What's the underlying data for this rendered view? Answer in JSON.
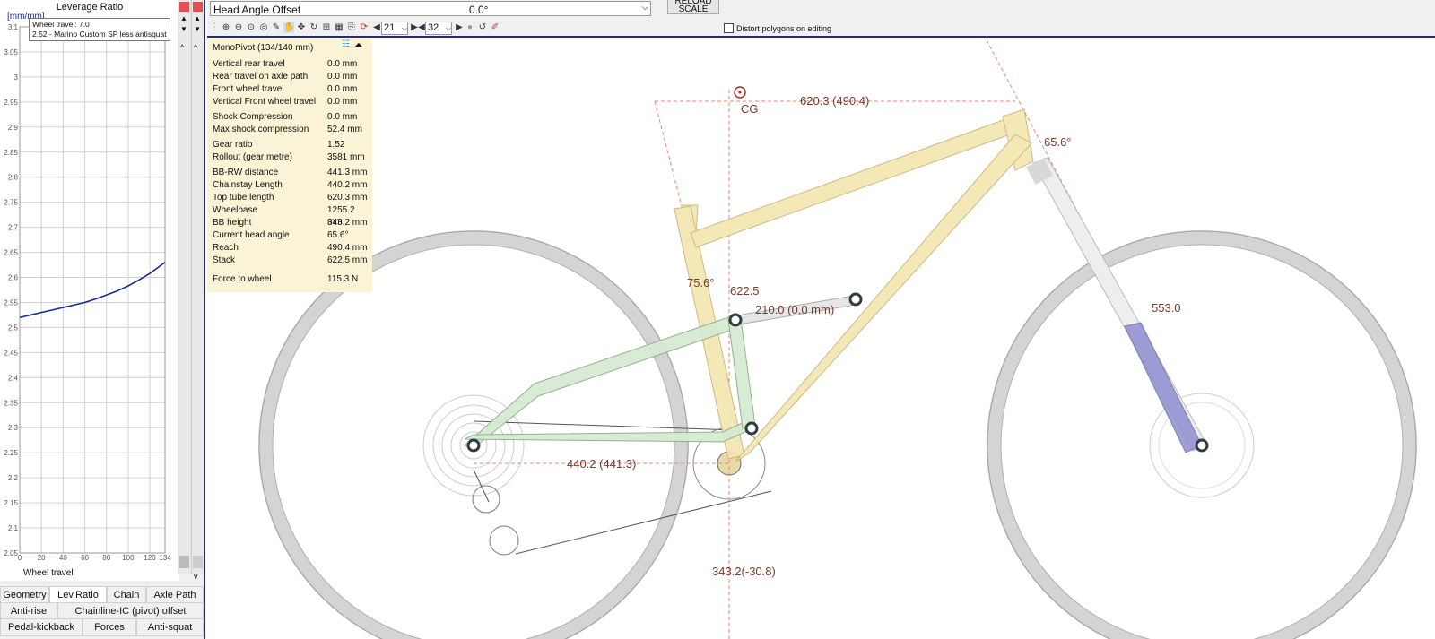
{
  "chart": {
    "title": "Leverage Ratio",
    "y_unit": "[mm/mm]",
    "x_axis_title": "Wheel travel",
    "tooltip_line1": "Wheel travel: 7.0",
    "tooltip_line2": "2.52 - Marino Custom SP less antisquat",
    "y_ticks": [
      "3.1",
      "3.05",
      "3",
      "2.95",
      "2.9",
      "2.85",
      "2.8",
      "2.75",
      "2.7",
      "2.65",
      "2.6",
      "2.55",
      "2.5",
      "2.45",
      "2.4",
      "2.35",
      "2.3",
      "2.25",
      "2.2",
      "2.15",
      "2.1",
      "2.05"
    ],
    "x_ticks": [
      "0",
      "20",
      "40",
      "60",
      "80",
      "100",
      "120",
      "134"
    ],
    "line_color": "#1a2a9a"
  },
  "chart_data": {
    "type": "line",
    "title": "Leverage Ratio",
    "xlabel": "Wheel travel",
    "ylabel": "[mm/mm]",
    "xlim": [
      0,
      134
    ],
    "ylim": [
      2.05,
      3.1
    ],
    "grid": true,
    "x": [
      0,
      10,
      20,
      30,
      40,
      50,
      60,
      70,
      80,
      90,
      100,
      110,
      120,
      134
    ],
    "series": [
      {
        "values": [
          2.52,
          2.525,
          2.53,
          2.535,
          2.54,
          2.545,
          2.55,
          2.557,
          2.565,
          2.573,
          2.583,
          2.595,
          2.608,
          2.63
        ]
      }
    ]
  },
  "tabs": {
    "row1": [
      "Geometry",
      "Lev.Ratio",
      "Chain",
      "Axle Path"
    ],
    "row2": [
      "Anti-rise",
      "Chainline-IC (pivot) offset"
    ],
    "row3": [
      "Pedal-kickback",
      "Forces",
      "Anti-squat"
    ],
    "active": "Lev.Ratio"
  },
  "toolbar": {
    "param_name": "Head Angle Offset",
    "param_value": "0.0°",
    "reload_label": "RELOAD SCALE",
    "spin1_value": "21",
    "spin2_value": "32",
    "distort_label": "Distort polygons on editing"
  },
  "info": {
    "title": "MonoPivot (134/140 mm)",
    "rows": [
      {
        "label": "Vertical rear travel",
        "value": "0.0 mm"
      },
      {
        "label": "Rear travel on axle path",
        "value": "0.0 mm"
      },
      {
        "label": "Front wheel travel",
        "value": "0.0 mm"
      },
      {
        "label": "Vertical Front wheel travel",
        "value": "0.0 mm"
      },
      {
        "label": "Shock Compression",
        "value": "0.0 mm"
      },
      {
        "label": "Max shock compression",
        "value": "52.4 mm"
      },
      {
        "label": "Gear ratio",
        "value": "1.52"
      },
      {
        "label": "Rollout (gear metre)",
        "value": "3581 mm"
      },
      {
        "label": "BB-RW distance",
        "value": "441.3 mm"
      },
      {
        "label": "Chainstay Length",
        "value": "440.2 mm"
      },
      {
        "label": "Top tube length",
        "value": "620.3 mm"
      },
      {
        "label": "Wheelbase",
        "value": "1255.2 mm"
      },
      {
        "label": "BB height",
        "value": "343.2 mm"
      },
      {
        "label": "Current head angle",
        "value": "65.6°"
      },
      {
        "label": "Reach",
        "value": "490.4 mm"
      },
      {
        "label": "Stack",
        "value": "622.5 mm"
      },
      {
        "label": "Force to wheel",
        "value": "115.3 N"
      }
    ]
  },
  "drawing": {
    "cg_label": "CG",
    "top_tube_dim": "620.3 (490.4)",
    "head_angle_dim": "65.6°",
    "seat_angle_dim": "75.6°",
    "stack_dim": "622.5",
    "shock_dim": "210.0 (0.0 mm)",
    "fork_dim": "553.0",
    "chainstay_dim": "440.2 (441.3)",
    "bb_height_dim": "343.2(-30.8)",
    "frame_color": "#f5e6b0",
    "swingarm_color": "#d6ead2",
    "fork_lower_color": "#8f8fd0"
  }
}
